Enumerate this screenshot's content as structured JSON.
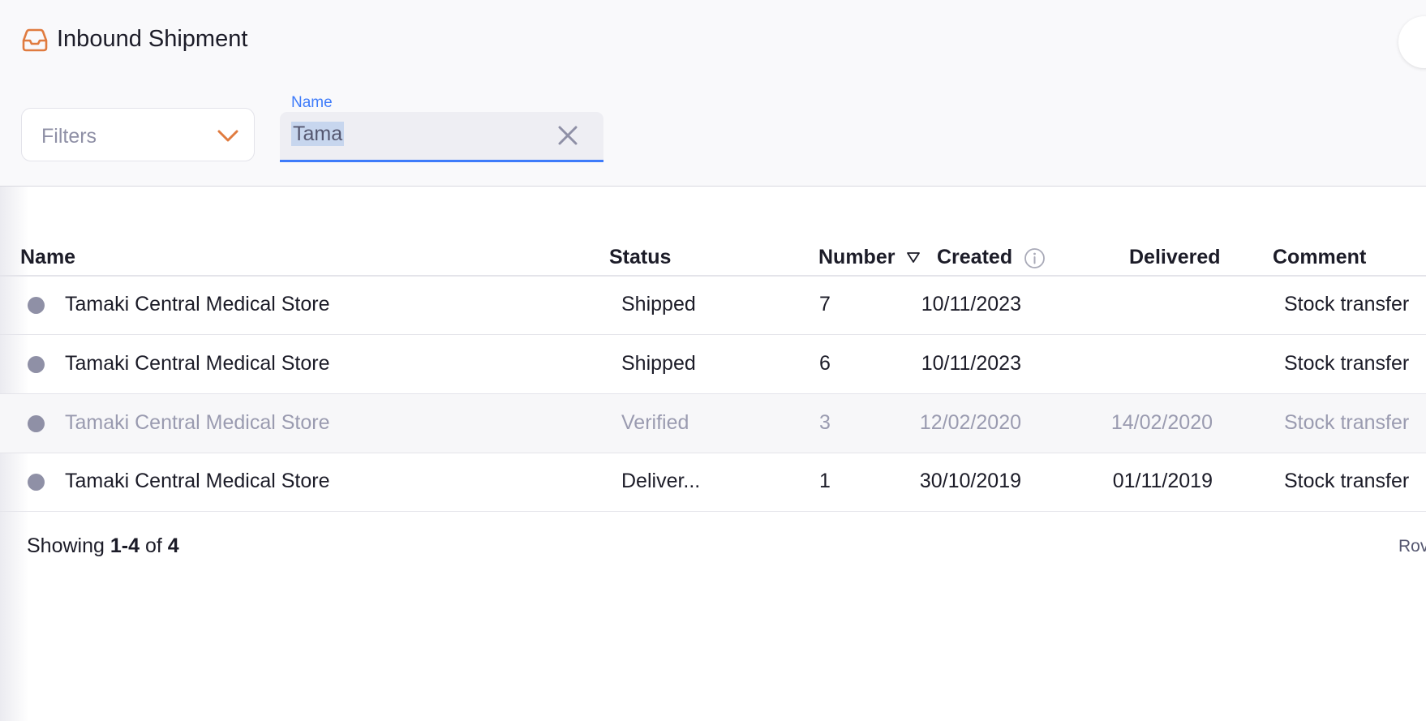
{
  "header": {
    "title": "Inbound Shipment",
    "title_icon": "inbox-icon",
    "accent_color": "#e07b3f"
  },
  "filters": {
    "label": "Filters"
  },
  "search": {
    "label": "Name",
    "value": "Tama",
    "accent_color": "#3e7bfa"
  },
  "table": {
    "columns": {
      "name": "Name",
      "status": "Status",
      "number": "Number",
      "created": "Created",
      "delivered": "Delivered",
      "comment": "Comment"
    },
    "sort": {
      "column": "number",
      "direction": "descending"
    },
    "rows": [
      {
        "name": "Tamaki Central Medical Store",
        "status": "Shipped",
        "number": "7",
        "created": "10/11/2023",
        "delivered": "",
        "comment": "Stock transfer"
      },
      {
        "name": "Tamaki Central Medical Store",
        "status": "Shipped",
        "number": "6",
        "created": "10/11/2023",
        "delivered": "",
        "comment": "Stock transfer"
      },
      {
        "name": "Tamaki Central Medical Store",
        "status": "Verified",
        "number": "3",
        "created": "12/02/2020",
        "delivered": "14/02/2020",
        "comment": "Stock transfer"
      },
      {
        "name": "Tamaki Central Medical Store",
        "status": "Deliver...",
        "number": "1",
        "created": "30/10/2019",
        "delivered": "01/11/2019",
        "comment": "Stock transfer"
      }
    ]
  },
  "pagination": {
    "showing_prefix": "Showing",
    "range": "1-4",
    "of_word": "of",
    "total": "4",
    "rows_label": "Rov"
  }
}
